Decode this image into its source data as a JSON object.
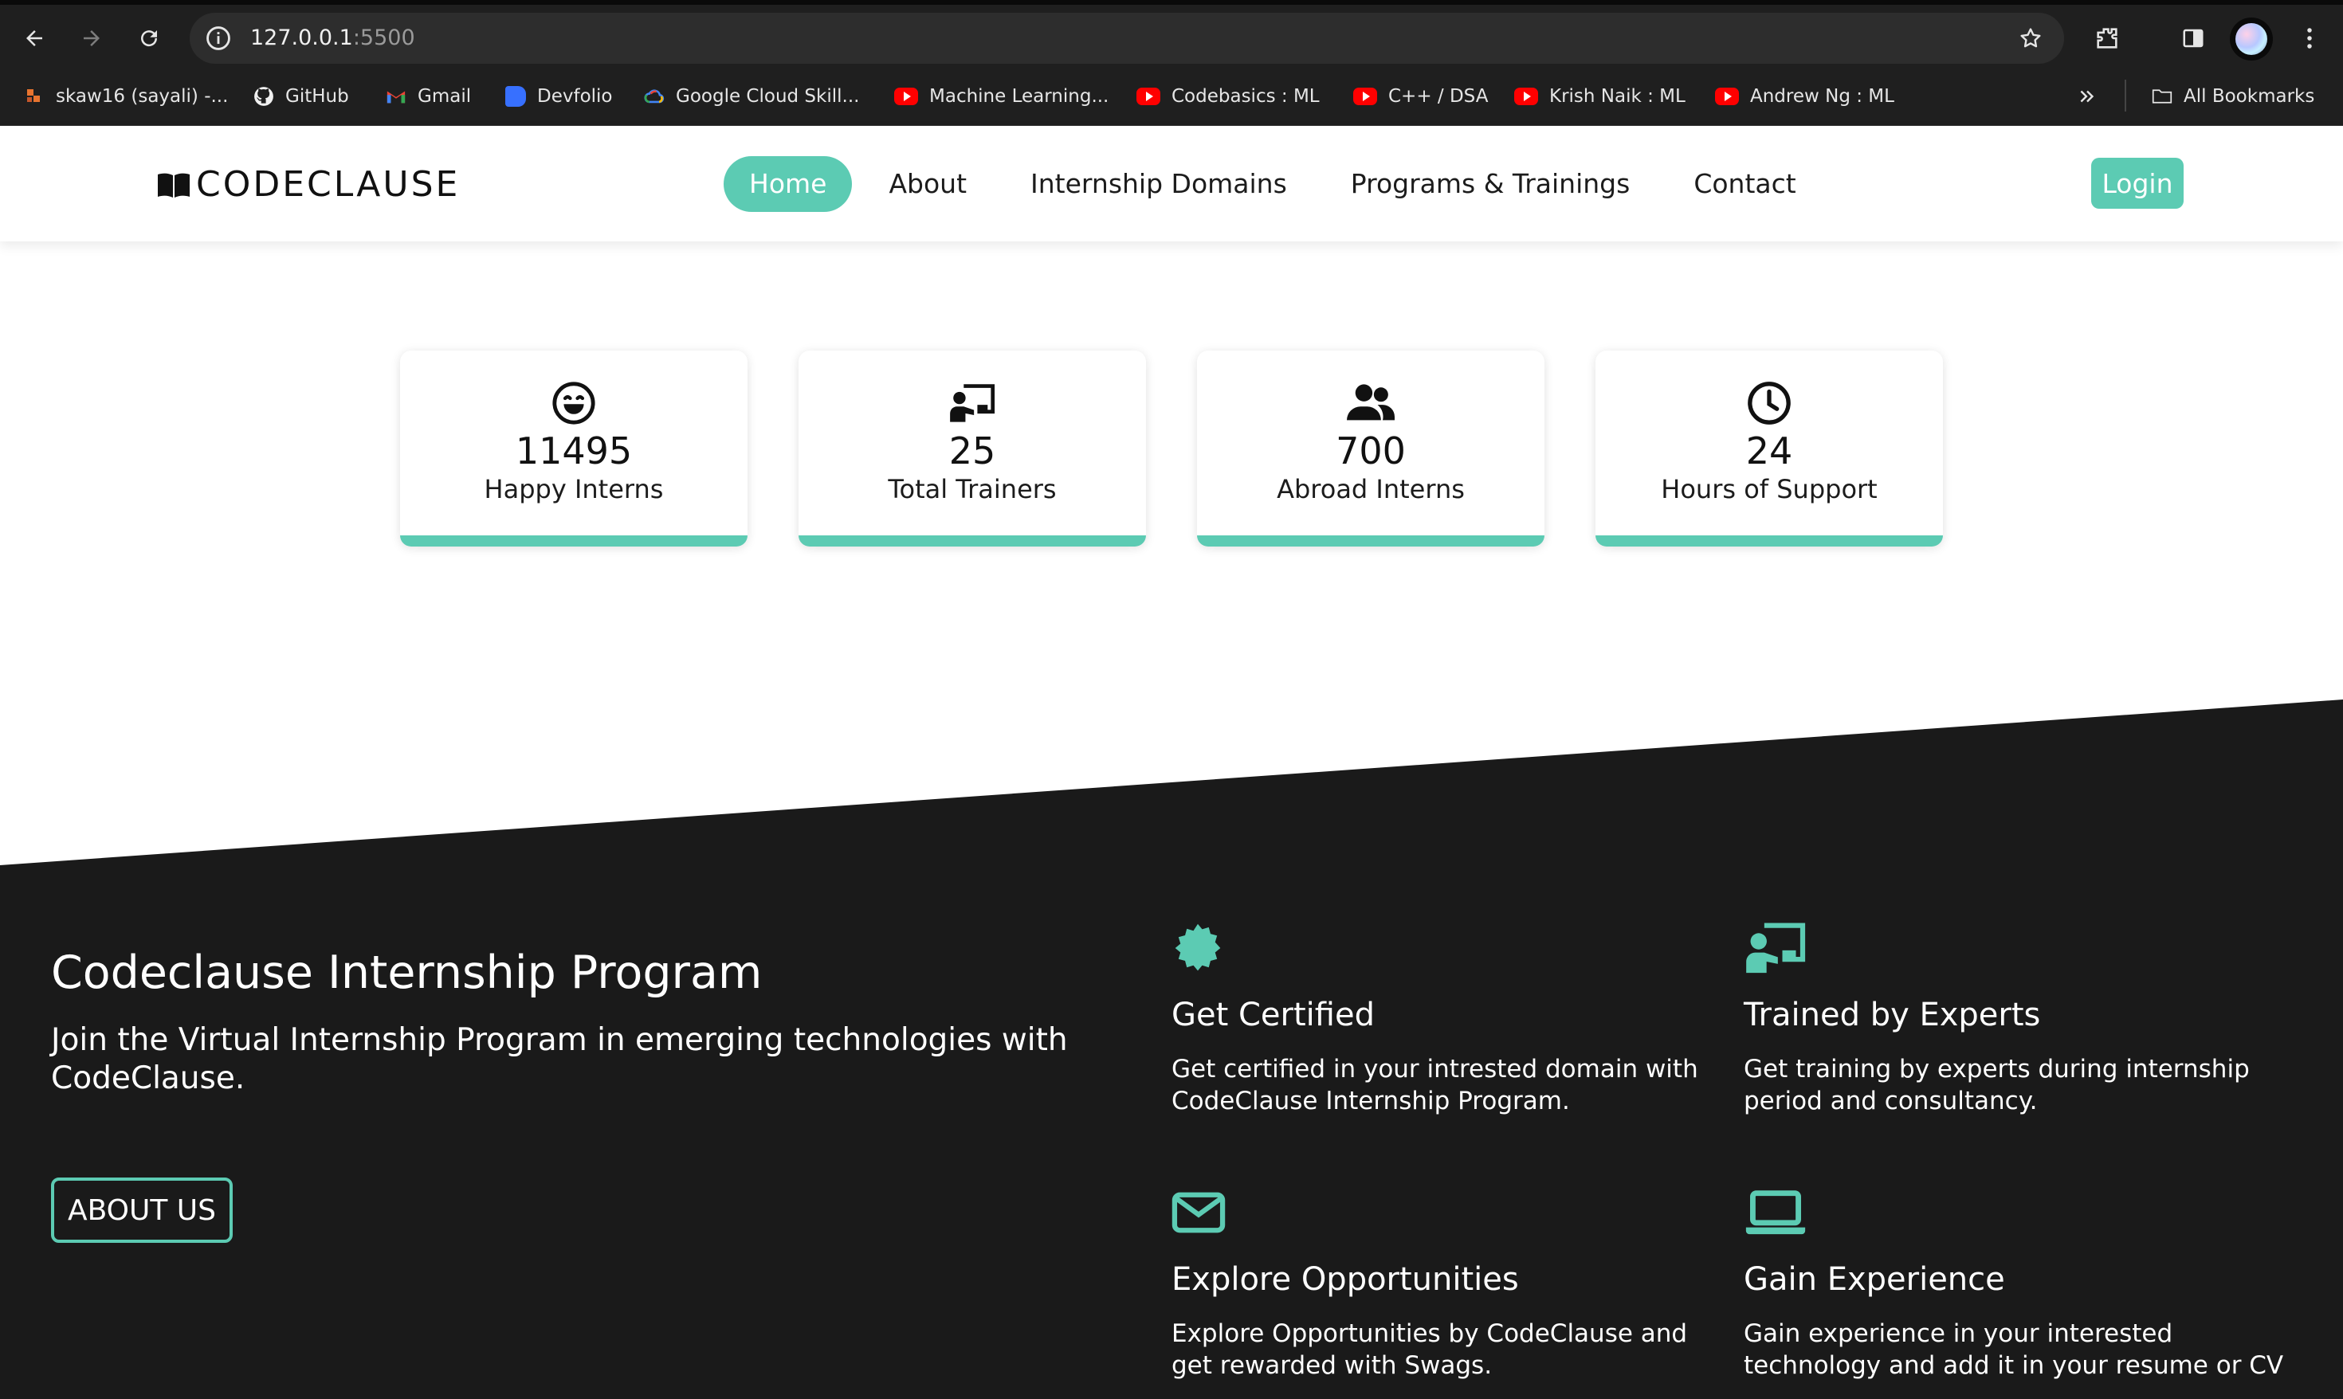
{
  "browser": {
    "url_host": "127.0.0.1",
    "url_port": ":5500",
    "bookmarks": [
      {
        "label": "skaw16 (sayali) -...",
        "icon": "bookmark-site-icon"
      },
      {
        "label": "GitHub",
        "icon": "github-icon"
      },
      {
        "label": "Gmail",
        "icon": "gmail-icon"
      },
      {
        "label": "Devfolio",
        "icon": "devfolio-icon"
      },
      {
        "label": "Google Cloud Skill...",
        "icon": "google-cloud-icon"
      },
      {
        "label": "Machine Learning...",
        "icon": "youtube-icon"
      },
      {
        "label": "Codebasics : ML",
        "icon": "youtube-icon"
      },
      {
        "label": "C++ / DSA",
        "icon": "youtube-icon"
      },
      {
        "label": "Krish Naik : ML",
        "icon": "youtube-icon"
      },
      {
        "label": "Andrew Ng : ML",
        "icon": "youtube-icon"
      }
    ],
    "all_bookmarks": "All Bookmarks"
  },
  "header": {
    "logo_text": "CODECLAUSE",
    "nav": [
      "Home",
      "About",
      "Internship Domains",
      "Programs & Trainings",
      "Contact"
    ],
    "active_nav": "Home",
    "login": "Login"
  },
  "stats": [
    {
      "number": "11495",
      "label": "Happy Interns",
      "icon": "laughing-face-icon"
    },
    {
      "number": "25",
      "label": "Total Trainers",
      "icon": "trainer-board-icon"
    },
    {
      "number": "700",
      "label": "Abroad Interns",
      "icon": "users-icon"
    },
    {
      "number": "24",
      "label": "Hours of Support",
      "icon": "clock-icon"
    }
  ],
  "program": {
    "title": "Codeclause Internship Program",
    "description": "Join the Virtual Internship Program in emerging technologies with CodeClause.",
    "button": "ABOUT US"
  },
  "features": [
    {
      "title": "Get Certified",
      "text": "Get certified in your intrested domain with CodeClause Internship Program.",
      "icon": "certificate-badge-icon"
    },
    {
      "title": "Trained by Experts",
      "text": "Get training by experts during internship period and consultancy.",
      "icon": "trainer-board-icon"
    },
    {
      "title": "Explore Opportunities",
      "text": "Explore Opportunities by CodeClause and get rewarded with Swags.",
      "icon": "envelope-icon"
    },
    {
      "title": "Gain Experience",
      "text": "Gain experience in your interested technology and add it in your resume or CV",
      "icon": "laptop-icon"
    }
  ],
  "colors": {
    "accent": "#5ccbb3",
    "dark_bg": "#1a1a1a",
    "browser_bg": "#1f1f1f"
  }
}
